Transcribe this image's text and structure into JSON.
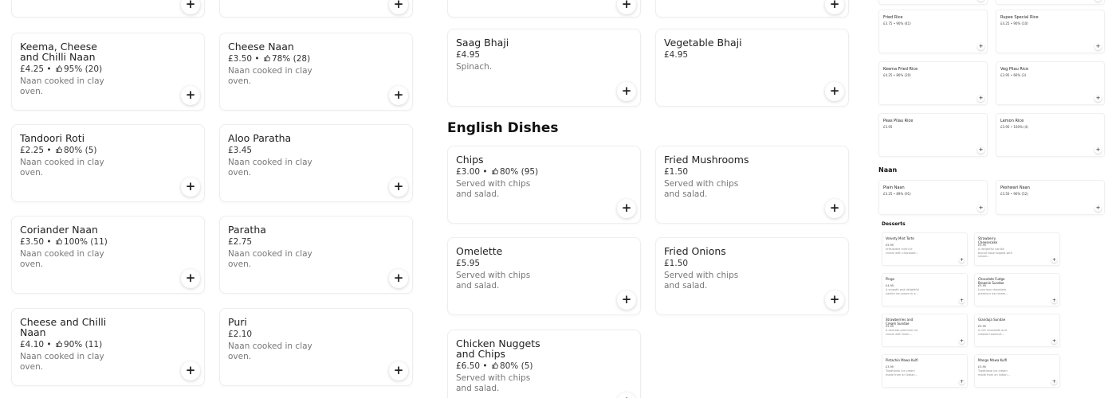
{
  "add_symbol": "+",
  "thumb_icon": "thumbs-up-icon",
  "col1": [
    {
      "name": "Keema, Cheese and Chilli Naan",
      "price": "£4.25",
      "rating": "95% (20)",
      "desc": "Naan cooked in clay oven."
    },
    {
      "name": "Tandoori Roti",
      "price": "£2.25",
      "rating": "80% (5)",
      "desc": "Naan cooked in clay oven."
    },
    {
      "name": "Coriander Naan",
      "price": "£3.50",
      "rating": "100% (11)",
      "desc": "Naan cooked in clay oven."
    },
    {
      "name": "Cheese and Chilli Naan",
      "price": "£4.10",
      "rating": "90% (11)",
      "desc": "Naan cooked in clay oven."
    }
  ],
  "col2": [
    {
      "name": "Cheese Naan",
      "price": "£3.50",
      "rating": "78% (28)",
      "desc": "Naan cooked in clay oven."
    },
    {
      "name": "Aloo Paratha",
      "price": "£3.45",
      "rating": "",
      "desc": "Naan cooked in clay oven."
    },
    {
      "name": "Paratha",
      "price": "£2.75",
      "rating": "",
      "desc": "Naan cooked in clay oven."
    },
    {
      "name": "Puri",
      "price": "£2.10",
      "rating": "",
      "desc": "Naan cooked in clay oven."
    }
  ],
  "bhaji": [
    {
      "name": "Saag Bhaji",
      "price": "£4.95",
      "rating": "",
      "desc": "Spinach."
    },
    {
      "name": "Vegetable Bhaji",
      "price": "£4.95",
      "rating": "",
      "desc": ""
    }
  ],
  "english_title": "English Dishes",
  "english": [
    {
      "name": "Chips",
      "price": "£3.00",
      "rating": "80% (95)",
      "desc": "Served with chips and salad."
    },
    {
      "name": "Fried Mushrooms",
      "price": "£1.50",
      "rating": "",
      "desc": "Served with chips and salad."
    },
    {
      "name": "Omelette",
      "price": "£5.95",
      "rating": "",
      "desc": "Served with chips and salad."
    },
    {
      "name": "Fried Onions",
      "price": "£1.50",
      "rating": "",
      "desc": "Served with chips and salad."
    },
    {
      "name": "Chicken Nuggets and Chips",
      "price": "£6.50",
      "rating": "80% (5)",
      "desc": "Served with chips and salad."
    }
  ],
  "mini_rice": [
    {
      "name": "Fried Rice",
      "meta": "£3.75 • 90% (41)"
    },
    {
      "name": "Rupee Special Rice",
      "meta": "£4.25 • 90% (10)"
    },
    {
      "name": "Keema Fried Rice",
      "meta": "£4.25 • 80% (20)"
    },
    {
      "name": "Veg Pilau Rice",
      "meta": "£3.95 • 66% (3)"
    },
    {
      "name": "Peas Pilau Rice",
      "meta": "£3.95"
    },
    {
      "name": "Lemon Rice",
      "meta": "£3.95 • 100% (4)"
    }
  ],
  "mini_naan_title": "Naan",
  "mini_naan": [
    {
      "name": "Plain Naan",
      "meta": "£3.25 • 89% (91)"
    },
    {
      "name": "Peshwari Naan",
      "meta": "£3.50 • 90% (52)"
    }
  ],
  "mini_desserts_title": "Desserts",
  "mini_desserts": [
    {
      "name": "Velvety Mint Torte",
      "meta": "£5.95",
      "desc": "Irresistible mint ice cream with chocolate..."
    },
    {
      "name": "Strawberry Cheesecake",
      "meta": "£5.95",
      "desc": "A delightful vanilla biscuit base topped with smoot..."
    },
    {
      "name": "Pingo",
      "meta": "£4.95",
      "desc": "A smooth and delightful vanilla ice-cream in a..."
    },
    {
      "name": "Chocolate Fudge Brownie Sundae",
      "meta": "£5.95",
      "desc": "Luxurious chocolate premium ice cream..."
    },
    {
      "name": "Strawberries and Cream Sundae",
      "meta": "£5.95",
      "desc": "A delicate premium ice cream with fresh..."
    },
    {
      "name": "Gianduja Sundae",
      "meta": "£5.95",
      "desc": "A rich chocolate and roasted hazelnut..."
    },
    {
      "name": "Pistachio Mawa Kulfi",
      "meta": "£3.95",
      "desc": "Traditional ice-cream made from an Indian..."
    },
    {
      "name": "Mango Mawa Kulfi",
      "meta": "£3.95",
      "desc": "Traditional ice-cream made from an Indian..."
    }
  ]
}
